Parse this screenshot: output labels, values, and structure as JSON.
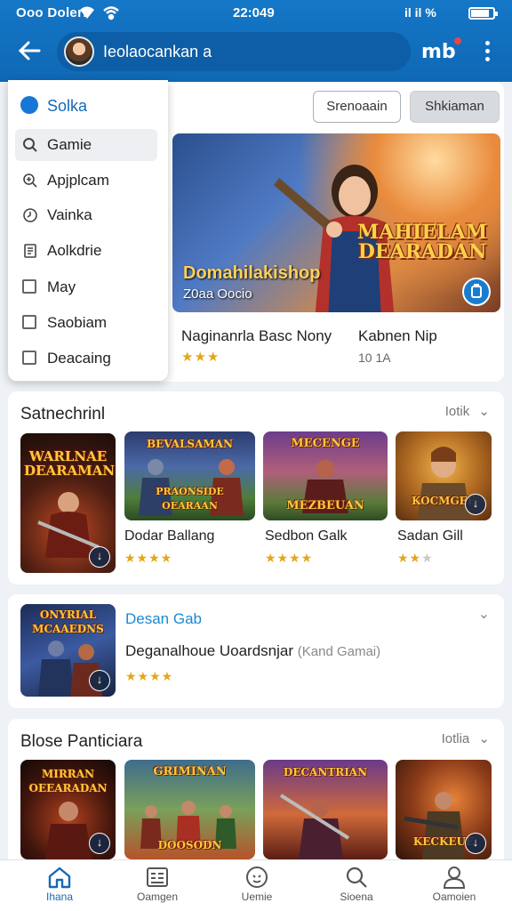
{
  "status_bar": {
    "carrier": "Ooo Doleri",
    "clock": "22:049",
    "right_icons": "il  il  %"
  },
  "app_bar": {
    "search_query": "Ieolaocankan a",
    "badge_text": "mb"
  },
  "menu": {
    "header": "Solka",
    "items": [
      {
        "label": "Gamie",
        "icon": "search-icon",
        "selected": true
      },
      {
        "label": "Apjplcam",
        "icon": "zoom-icon"
      },
      {
        "label": "Vainka",
        "icon": "clock-icon"
      },
      {
        "label": "Aolkdrie",
        "icon": "document-icon"
      },
      {
        "label": "May",
        "icon": "checkbox-icon"
      },
      {
        "label": "Saobiam",
        "icon": "checkbox-icon"
      },
      {
        "label": "Deacaing",
        "icon": "checkbox-icon"
      }
    ]
  },
  "actions": {
    "outline_button": "Srenoaain",
    "filled_button": "Shkiaman"
  },
  "hero": {
    "title": "Domahilakishop",
    "subtitle": "Z0aa Oocio",
    "logo_text": "MAHIELAM DEARADAN",
    "name": "Naginanrla Basc Nony",
    "rating": "★★★",
    "name2": "Kabnen Nip",
    "meta": "10 1A"
  },
  "section1": {
    "title": "Satnechrinl",
    "link": "Iotik",
    "games": [
      {
        "art_text": "WARLNAE DEARAMAN",
        "name": "",
        "stars": 0,
        "style": "dark"
      },
      {
        "art_text": "BEVALSAMAN",
        "art_text2": "PRAONSIDE OEARAAN",
        "name": "Dodar Ballang",
        "stars": 4,
        "style": "forest"
      },
      {
        "art_text": "MECENGE",
        "art_text2": "MEZBEUAN",
        "name": "Sedbon Galk",
        "stars": 4,
        "style": "purple"
      },
      {
        "art_text": "KOCMGEE",
        "name": "Sadan Gill",
        "stars": 2,
        "style": "amber"
      }
    ]
  },
  "section2": {
    "title": "Desan Gab",
    "subtitle": "Deganalhoue Uoardsnjar",
    "subtitle_muted": "(Kand Gamai)",
    "stars": 4,
    "art_text": "ONYRIAL MCAAEDNS"
  },
  "section3": {
    "title": "Blose Panticiara",
    "link": "Iotlia",
    "games": [
      {
        "art_text": "MIRRAN OEEARADAN",
        "style": "dark"
      },
      {
        "art_text": "GRIMINAN",
        "art_text2": "DOOSODN",
        "style": "jungle"
      },
      {
        "art_text": "DECANTRIAN",
        "style": "sunset"
      },
      {
        "art_text": "KECKEUE",
        "style": "amber"
      }
    ]
  },
  "bottom_nav": [
    {
      "label": "Ihana",
      "icon": "home-icon",
      "active": true
    },
    {
      "label": "Oamgen",
      "icon": "list-icon"
    },
    {
      "label": "Uemie",
      "icon": "face-icon"
    },
    {
      "label": "Sioena",
      "icon": "search-icon"
    },
    {
      "label": "Oamoien",
      "icon": "profile-icon"
    }
  ],
  "colors": {
    "primary": "#1669b7",
    "appbar": "#1477c7",
    "star": "#e2a719"
  }
}
